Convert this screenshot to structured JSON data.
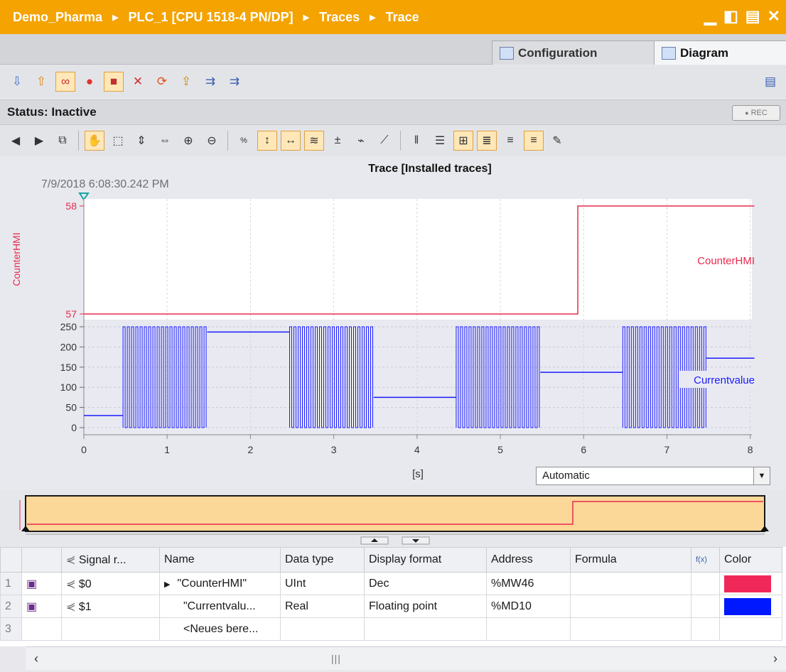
{
  "title": {
    "crumbs": [
      "Demo_Pharma",
      "PLC_1 [CPU 1518-4 PN/DP]",
      "Traces",
      "Trace"
    ]
  },
  "tabs": [
    {
      "label": "Configuration",
      "active": false
    },
    {
      "label": "Diagram",
      "active": true
    }
  ],
  "status": {
    "text": "Status: Inactive",
    "rec_label": "REC"
  },
  "diagram": {
    "title": "Trace [Installed traces]",
    "timestamp": "7/9/2018  6:08:30.242 PM",
    "x_unit": "[s]",
    "x_mode": "Automatic"
  },
  "chart_data": {
    "type": "line",
    "x": {
      "label": "[s]",
      "range": [
        0,
        8
      ],
      "ticks": [
        "0",
        "1",
        "2",
        "3",
        "4",
        "5",
        "6",
        "7",
        "8"
      ]
    },
    "series": [
      {
        "name": "CounterHMI",
        "color": "#e8294f",
        "axis_label": "CounterHMI",
        "y_ticks": [
          "57",
          "58"
        ],
        "ylim": [
          57,
          58
        ],
        "steps": [
          [
            0,
            57
          ],
          [
            5.93,
            58
          ],
          [
            8.05,
            58
          ]
        ]
      },
      {
        "name": "Currentvalue",
        "color": "#1a1aff",
        "y_ticks": [
          "0",
          "50",
          "100",
          "150",
          "200",
          "250"
        ],
        "ylim": [
          0,
          260
        ],
        "constant_segments": [
          [
            0,
            0.47,
            30
          ],
          [
            1.48,
            2.47,
            237
          ],
          [
            3.48,
            4.47,
            75
          ],
          [
            5.48,
            6.47,
            137
          ],
          [
            7.47,
            8.05,
            172
          ]
        ],
        "oscillation_segments": [
          [
            0.47,
            1.48
          ],
          [
            2.47,
            3.48
          ],
          [
            4.47,
            5.48
          ],
          [
            6.47,
            7.47
          ]
        ],
        "oscillation_range": [
          0,
          250
        ]
      }
    ]
  },
  "table": {
    "headers": [
      "Signal r...",
      "Name",
      "Data type",
      "Display format",
      "Address",
      "Formula",
      "Color"
    ],
    "rows": [
      {
        "n": "1",
        "sig": "$0",
        "name": "\"CounterHMI\"",
        "dtype": "UInt",
        "fmt": "Dec",
        "addr": "%MW46",
        "formula": "",
        "color": "#f0285a"
      },
      {
        "n": "2",
        "sig": "$1",
        "name": "\"Currentvalu...",
        "dtype": "Real",
        "fmt": "Floating point",
        "addr": "%MD10",
        "formula": "",
        "color": "#0018ff"
      },
      {
        "n": "3",
        "sig": "",
        "name": "<Neues bere...",
        "dtype": "",
        "fmt": "",
        "addr": "",
        "formula": "",
        "color": ""
      }
    ]
  },
  "icons": {
    "window": [
      "minimize-icon",
      "restore-icon",
      "maximize-icon",
      "close-icon"
    ],
    "toolbar1": [
      "transfer-to-device-icon",
      "upload-from-device-icon",
      "observe-icon",
      "activate-recording-icon",
      "deactivate-recording-icon",
      "delete-trace-icon",
      "refresh-icon",
      "export-trace-icon",
      "import-trace-icon",
      "save-measurement-icon",
      "panel-toggle-icon"
    ],
    "toolbar2": [
      "back-icon",
      "forward-icon",
      "snapshot-icon",
      "hand-pan-icon",
      "zoom-window-icon",
      "zoom-vertical-icon",
      "zoom-horizontal-icon",
      "zoom-in-icon",
      "zoom-out-icon",
      "zoom-100-icon",
      "fit-y-icon",
      "fit-x-icon",
      "signal-lanes-icon",
      "signal-time-icon",
      "measurement-points-icon",
      "line-draw-icon",
      "vertical-cursor-icon",
      "horizontal-cursor-icon",
      "cursor-sync-icon",
      "legend-icon",
      "align-left-icon",
      "align-right-icon",
      "color-fill-icon"
    ]
  }
}
